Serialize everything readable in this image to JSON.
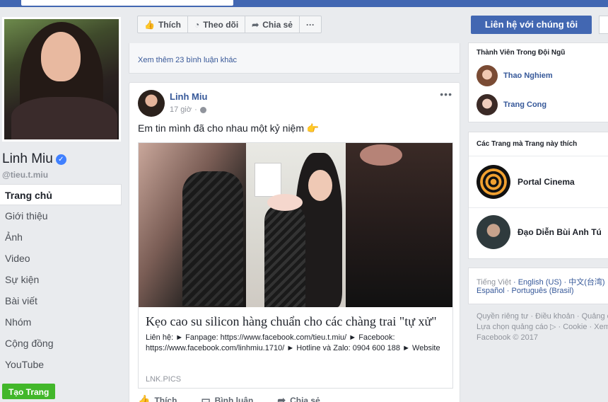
{
  "profile": {
    "name": "Linh Miu",
    "verified_icon": "✓",
    "username": "@tieu.t.miu"
  },
  "nav": {
    "items": [
      {
        "label": "Trang chủ",
        "active": true
      },
      {
        "label": "Giới thiệu"
      },
      {
        "label": "Ảnh"
      },
      {
        "label": "Video"
      },
      {
        "label": "Sự kiện"
      },
      {
        "label": "Bài viết"
      },
      {
        "label": "Nhóm"
      },
      {
        "label": "Cộng đồng"
      },
      {
        "label": "YouTube"
      }
    ],
    "create_page": "Tạo Trang"
  },
  "actions": {
    "like": "Thích",
    "follow": "Theo dõi",
    "share": "Chia sẻ",
    "more": "···"
  },
  "contact_button": "Liên hệ với chúng tôi",
  "more_comments": "Xem thêm 23 bình luận khác",
  "post": {
    "author": "Linh Miu",
    "time": "17 giờ",
    "menu": "•••",
    "text": "Em tin mình đã cho nhau một kỷ niệm",
    "emoji": "👉",
    "link": {
      "title": "Kẹo cao su silicon hàng chuẩn cho các chàng trai \"tự xử\"",
      "description": "Liên hệ: ► Fanpage: https://www.facebook.com/tieu.t.miu/ ► Facebook: https://www.facebook.com/linhmiu.1710/ ► Hotline và Zalo: 0904 600 188 ► Website",
      "domain": "LNK.PICS"
    },
    "footer_actions": {
      "like": "Thích",
      "comment": "Bình luận",
      "share": "Chia sẻ"
    }
  },
  "team": {
    "title": "Thành Viên Trong Đội Ngũ",
    "members": [
      {
        "name": "Thao Nghiem"
      },
      {
        "name": "Trang Cong"
      }
    ]
  },
  "liked_pages": {
    "title": "Các Trang mà Trang này thích",
    "pages": [
      {
        "name": "Portal Cinema"
      },
      {
        "name": "Đạo Diễn Bùi Anh Tú"
      }
    ]
  },
  "languages": {
    "current": "Tiếng Việt",
    "row1_rest": " · English (US) · 中文(台湾)",
    "row2": "Español · Português (Brasil)"
  },
  "footer": {
    "line1": "Quyền riêng tư · Điều khoản · Quảng cáo",
    "line2": "Lựa chọn quảng cáo ▷ · Cookie · Xem thêm",
    "line3": "Facebook © 2017"
  }
}
